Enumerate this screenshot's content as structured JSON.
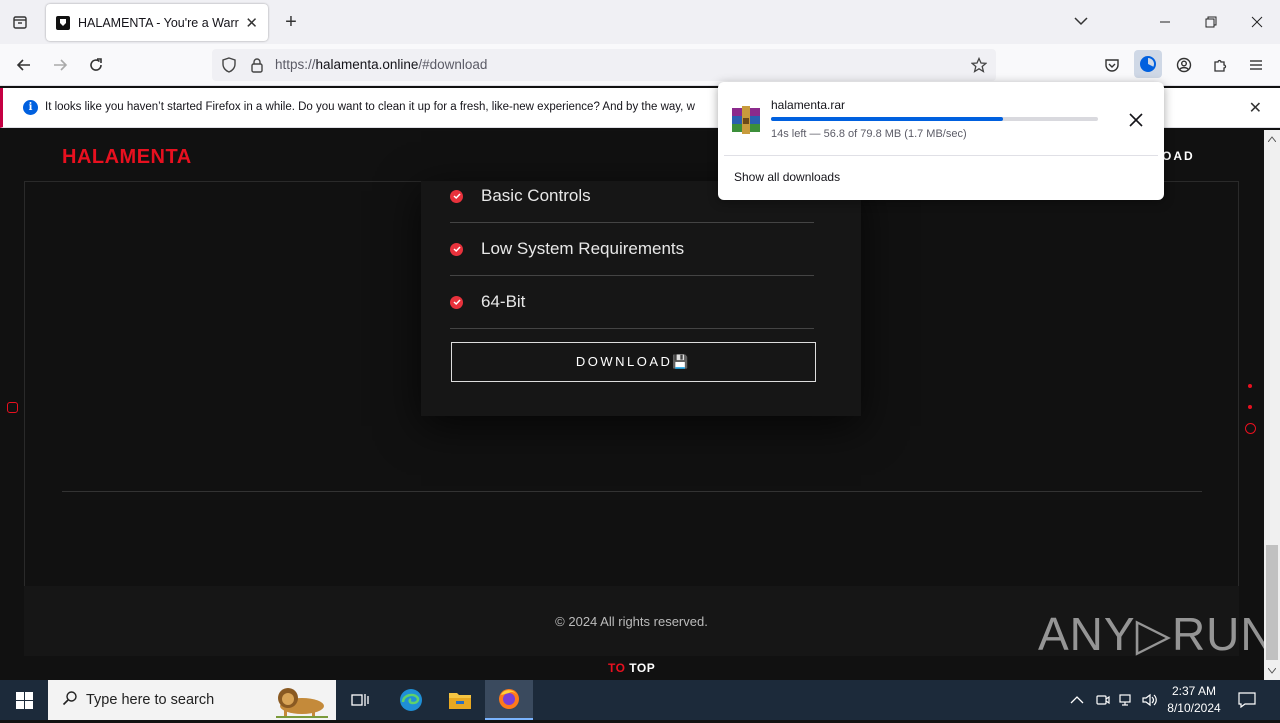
{
  "browser": {
    "tab_title": "HALAMENTA - You're a Warrior",
    "url_prefix": "https://",
    "url_domain": "halamenta.online",
    "url_path": "/#download",
    "notification": "It looks like you haven’t started Firefox in a while. Do you want to clean it up for a fresh, like-new experience? And by the way, w"
  },
  "page": {
    "logo": "HALAMENTA",
    "nav_item": "OAD",
    "features": [
      "Basic Controls",
      "Low System Requirements",
      "64-Bit"
    ],
    "download_button": "DOWNLOAD💾",
    "copyright": "© 2024 All rights reserved.",
    "to_top_red": "TO",
    "to_top_white": " TOP",
    "watermark": "ANY▷RUN"
  },
  "download": {
    "filename": "halamenta.rar",
    "status": "14s left — 56.8 of 79.8 MB (1.7 MB/sec)",
    "progress_fraction": 0.71,
    "show_all": "Show all downloads"
  },
  "taskbar": {
    "search_placeholder": "Type here to search",
    "time": "2:37 AM",
    "date": "8/10/2024"
  },
  "colors": {
    "brand_red": "#e8101f",
    "progress_blue": "#0060df"
  }
}
